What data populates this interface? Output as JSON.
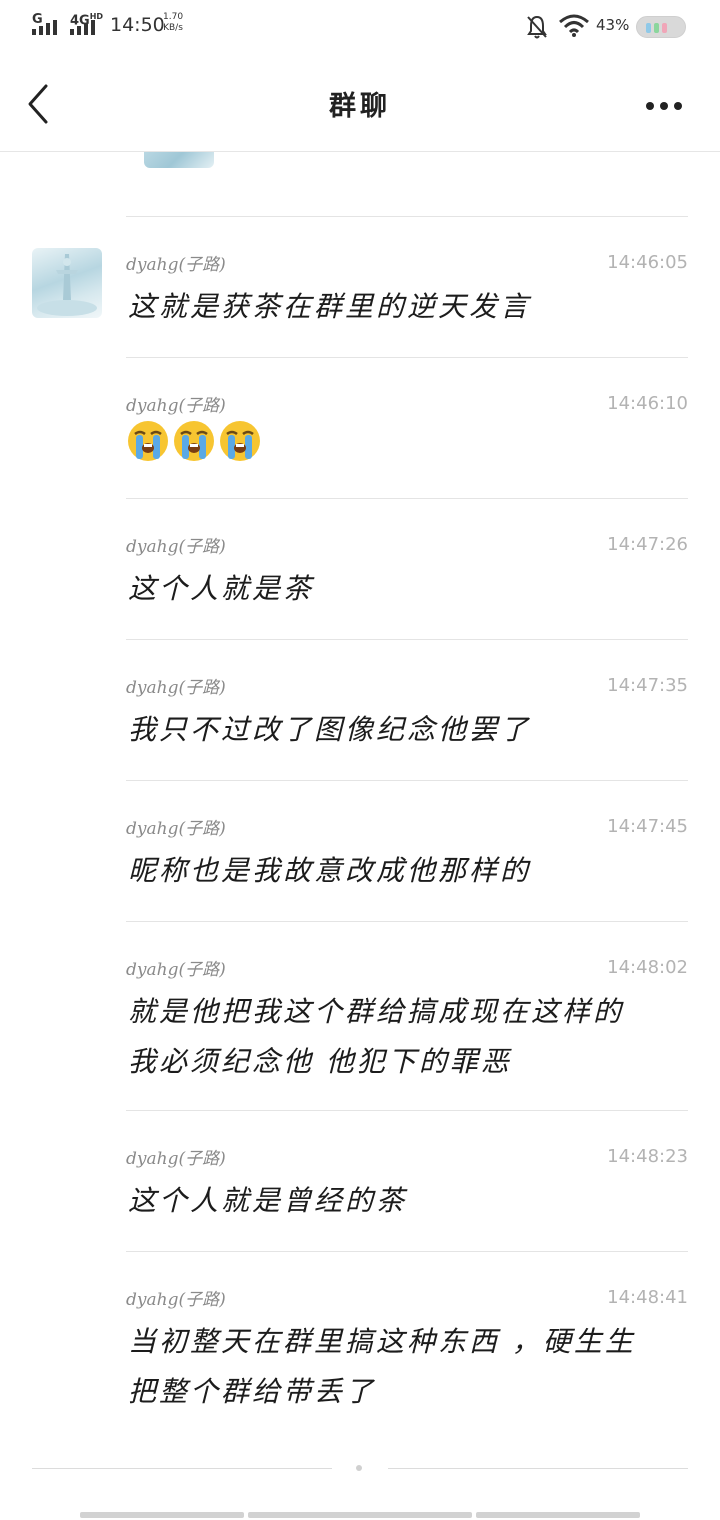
{
  "status_bar": {
    "network1": "G",
    "network2": "4G",
    "network2_sup": "HD",
    "time": "14:50",
    "speed_value": "1.70",
    "speed_unit": "KB/s",
    "battery_percent": "43%",
    "icons": [
      "signal-icon",
      "signal-icon",
      "mute-bell-icon",
      "wifi-icon",
      "battery-icon"
    ]
  },
  "header": {
    "back_icon": "chevron-left-icon",
    "title": "群聊",
    "more_icon": "more-dots-icon"
  },
  "messages": [
    {
      "sender": "dyahg(子路)",
      "time": "14:46:05",
      "text": "这就是获茶在群里的逆天发言",
      "has_avatar": true
    },
    {
      "sender": "dyahg(子路)",
      "time": "14:46:10",
      "emoji": [
        "loudly-crying-face-emoji",
        "loudly-crying-face-emoji",
        "loudly-crying-face-emoji"
      ]
    },
    {
      "sender": "dyahg(子路)",
      "time": "14:47:26",
      "text": "这个人就是茶"
    },
    {
      "sender": "dyahg(子路)",
      "time": "14:47:35",
      "text": "我只不过改了图像纪念他罢了"
    },
    {
      "sender": "dyahg(子路)",
      "time": "14:47:45",
      "text": "昵称也是我故意改成他那样的"
    },
    {
      "sender": "dyahg(子路)",
      "time": "14:48:02",
      "text_lines": [
        "就是他把我这个群给搞成现在这样的",
        "我必须纪念他 他犯下的罪恶"
      ]
    },
    {
      "sender": "dyahg(子路)",
      "time": "14:48:23",
      "text": "这个人就是曾经的茶"
    },
    {
      "sender": "dyahg(子路)",
      "time": "14:48:41",
      "text_lines": [
        "当初整天在群里搞这种东西 ，硬生生",
        "把整个群给带丢了"
      ]
    }
  ]
}
